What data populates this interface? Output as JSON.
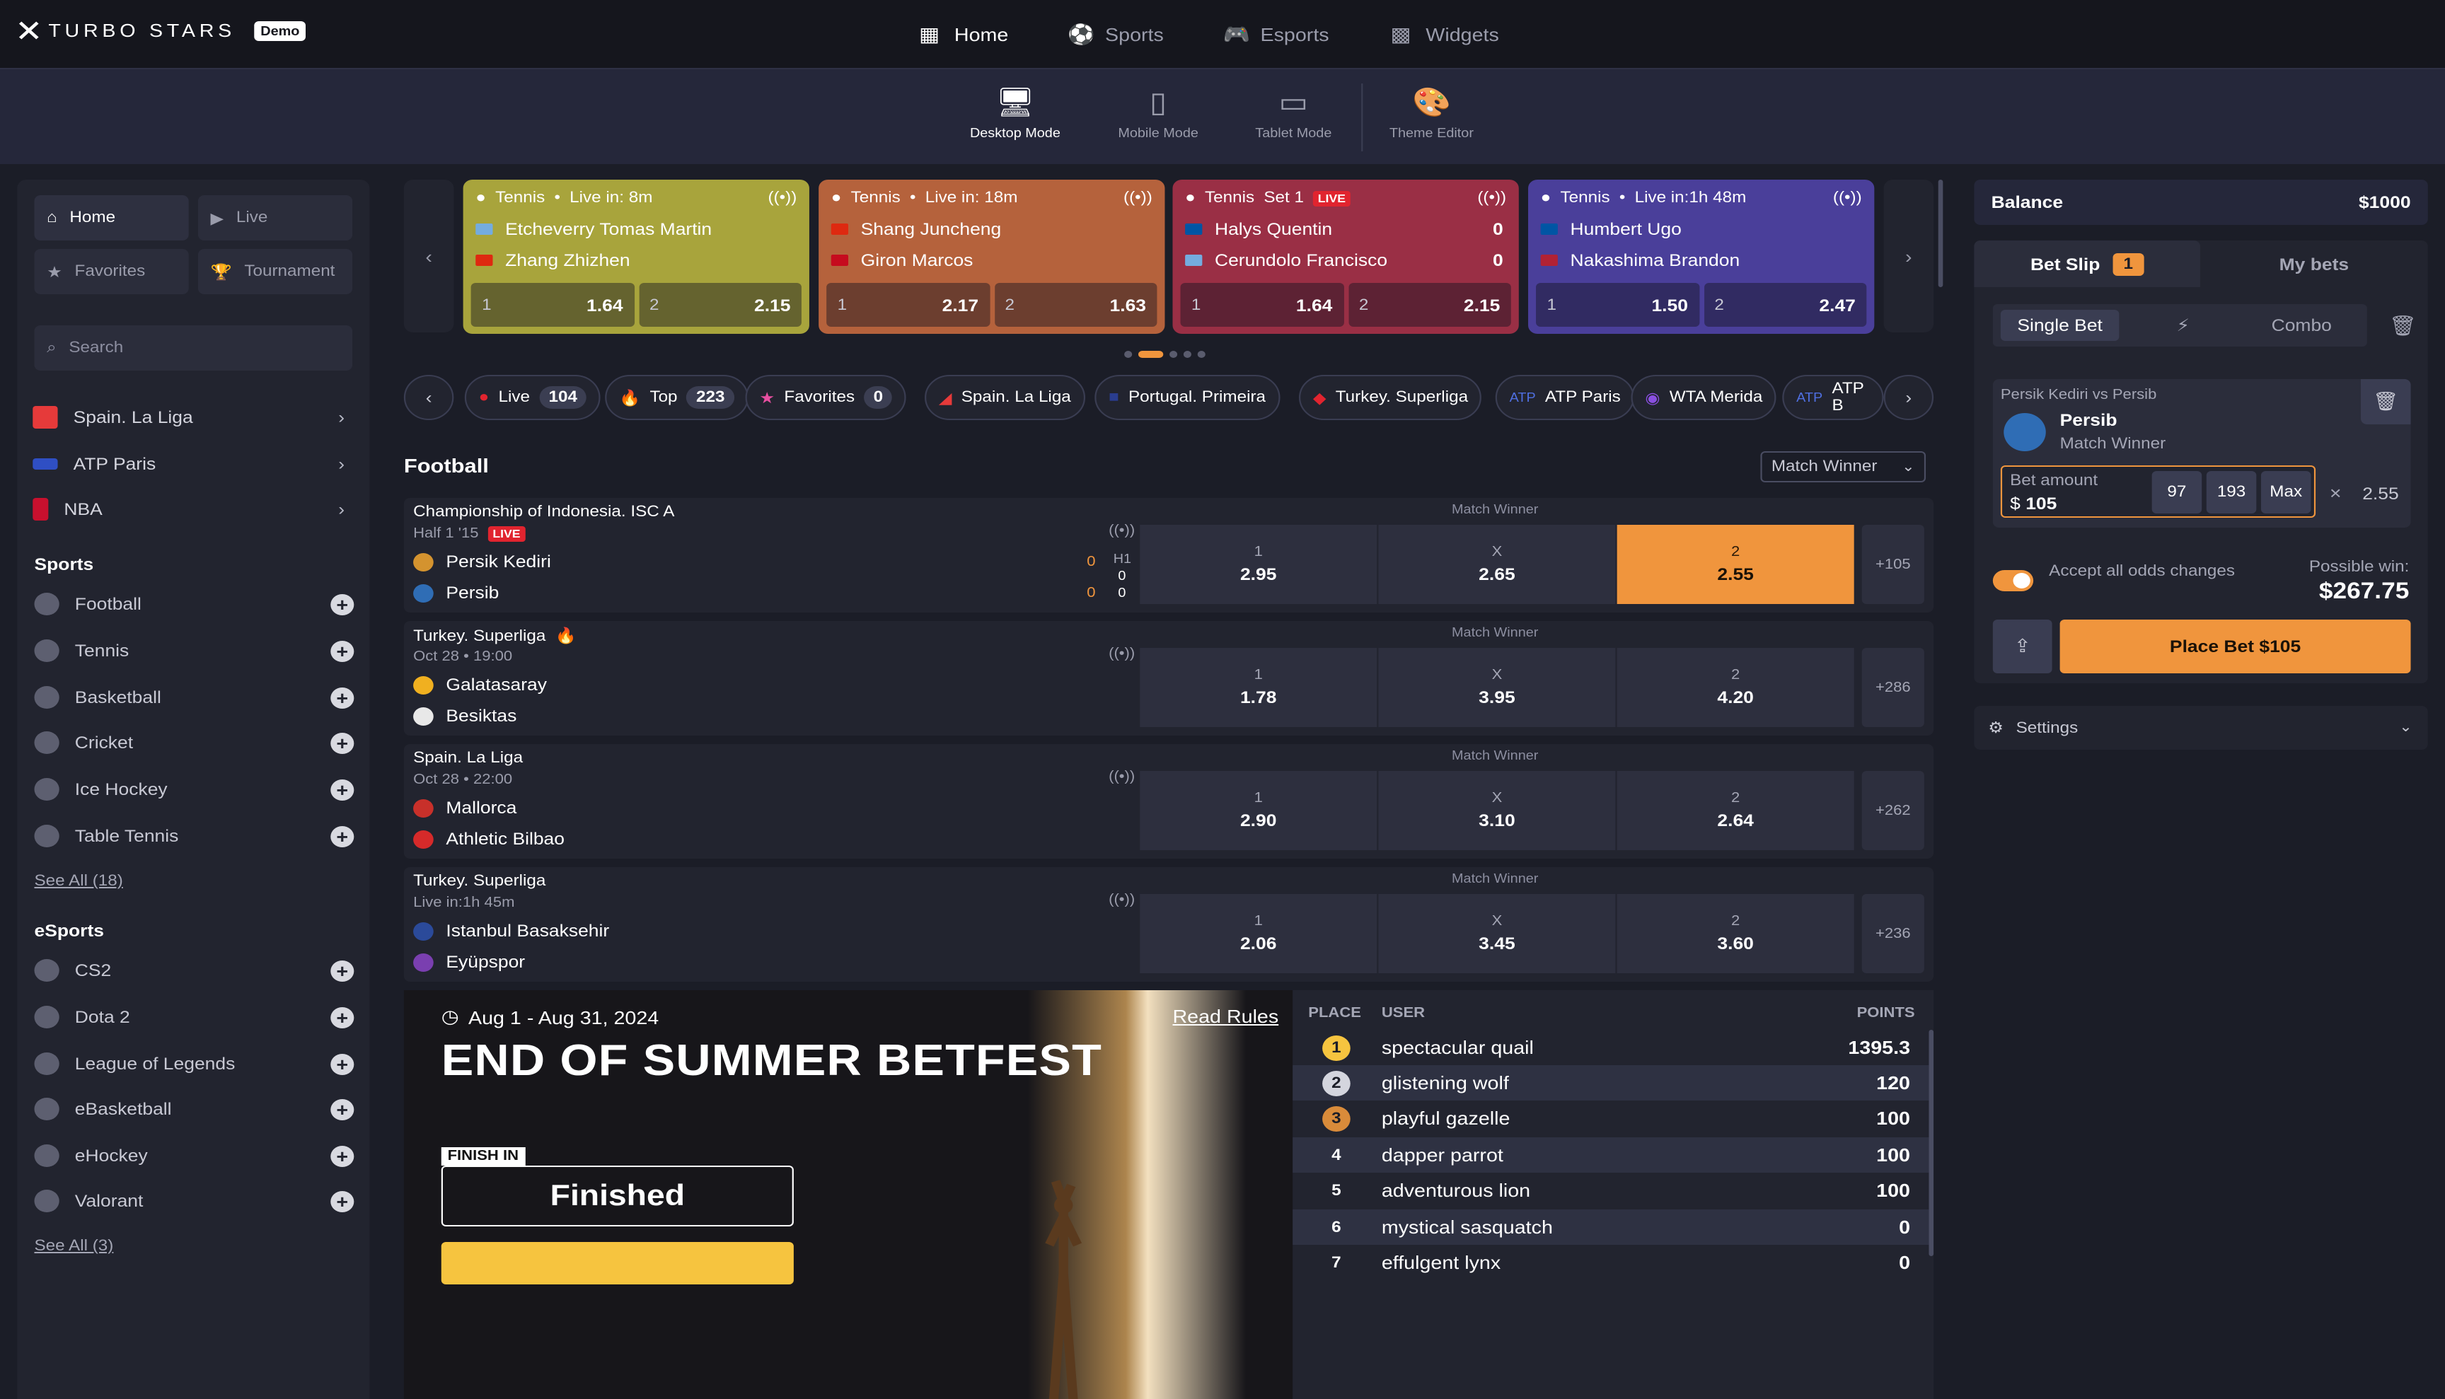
{
  "brand": {
    "name": "TURBO STARS",
    "badge": "Demo"
  },
  "topnav": [
    {
      "label": "Home",
      "icon": "grid-icon",
      "active": true
    },
    {
      "label": "Sports",
      "icon": "soccer-ball-icon",
      "active": false
    },
    {
      "label": "Esports",
      "icon": "gamepad-icon",
      "active": false
    },
    {
      "label": "Widgets",
      "icon": "widgets-icon",
      "active": false
    }
  ],
  "modes": [
    {
      "label": "Desktop Mode",
      "icon": "desktop-icon",
      "active": true
    },
    {
      "label": "Mobile Mode",
      "icon": "mobile-icon",
      "active": false
    },
    {
      "label": "Tablet Mode",
      "icon": "tablet-icon",
      "active": false
    },
    {
      "label": "Theme Editor",
      "icon": "palette-icon",
      "active": false
    }
  ],
  "sidebar": {
    "buttons": [
      {
        "label": "Home",
        "icon": "home-icon",
        "active": true
      },
      {
        "label": "Live",
        "icon": "play-icon",
        "active": false
      },
      {
        "label": "Favorites",
        "icon": "star-icon",
        "active": false
      },
      {
        "label": "Tournament",
        "icon": "trophy-icon",
        "active": false
      }
    ],
    "search_placeholder": "Search",
    "top_links": [
      {
        "label": "Spain. La Liga",
        "icon": "laliga-icon"
      },
      {
        "label": "ATP Paris",
        "icon": "atp-icon"
      },
      {
        "label": "NBA",
        "icon": "nba-icon"
      }
    ],
    "sports_title": "Sports",
    "sports": [
      {
        "label": "Football",
        "icon": "football-icon"
      },
      {
        "label": "Tennis",
        "icon": "tennis-icon"
      },
      {
        "label": "Basketball",
        "icon": "basketball-icon"
      },
      {
        "label": "Cricket",
        "icon": "cricket-icon"
      },
      {
        "label": "Ice Hockey",
        "icon": "ice-hockey-icon"
      },
      {
        "label": "Table Tennis",
        "icon": "table-tennis-icon"
      }
    ],
    "sports_see_all": "See All (18)",
    "esports_title": "eSports",
    "esports": [
      {
        "label": "CS2",
        "icon": "cs2-icon"
      },
      {
        "label": "Dota 2",
        "icon": "dota2-icon"
      },
      {
        "label": "League of Legends",
        "icon": "lol-icon"
      },
      {
        "label": "eBasketball",
        "icon": "ebasketball-icon"
      },
      {
        "label": "eHockey",
        "icon": "ehockey-icon"
      },
      {
        "label": "Valorant",
        "icon": "valorant-icon"
      }
    ],
    "esports_see_all": "See All (3)"
  },
  "live_cards": [
    {
      "sport": "Tennis",
      "status": "Live in: 8m",
      "live": false,
      "color": "#a8a43c",
      "team1": "Etcheverry Tomas Martin",
      "team2": "Zhang Zhizhen",
      "score1": "",
      "score2": "",
      "odds": [
        {
          "label": "1",
          "value": "1.64"
        },
        {
          "label": "2",
          "value": "2.15"
        }
      ]
    },
    {
      "sport": "Tennis",
      "status": "Live in: 18m",
      "live": false,
      "color": "#b5623c",
      "team1": "Shang Juncheng",
      "team2": "Giron Marcos",
      "score1": "",
      "score2": "",
      "odds": [
        {
          "label": "1",
          "value": "2.17"
        },
        {
          "label": "2",
          "value": "1.63"
        }
      ]
    },
    {
      "sport": "Tennis",
      "status": "Set 1",
      "live": true,
      "live_label": "LIVE",
      "color": "#9a2f45",
      "team1": "Halys Quentin",
      "team2": "Cerundolo Francisco",
      "score1": "0",
      "score2": "0",
      "odds": [
        {
          "label": "1",
          "value": "1.64"
        },
        {
          "label": "2",
          "value": "2.15"
        }
      ]
    },
    {
      "sport": "Tennis",
      "status": "Live in:1h 48m",
      "live": false,
      "color": "#4a3f9a",
      "team1": "Humbert Ugo",
      "team2": "Nakashima Brandon",
      "score1": "",
      "score2": "",
      "odds": [
        {
          "label": "1",
          "value": "1.50"
        },
        {
          "label": "2",
          "value": "2.47"
        }
      ]
    }
  ],
  "chips": [
    {
      "label": "Live",
      "count": "104",
      "icon": "live-dot-icon"
    },
    {
      "label": "Top",
      "count": "223",
      "icon": "fire-icon"
    },
    {
      "label": "Favorites",
      "count": "0",
      "icon": "star-icon"
    },
    {
      "label": "Spain. La Liga",
      "count": "",
      "icon": "laliga-icon"
    },
    {
      "label": "Portugal. Primeira",
      "count": "",
      "icon": "primeira-icon"
    },
    {
      "label": "Turkey. Superliga",
      "count": "",
      "icon": "superliga-icon"
    },
    {
      "label": "ATP Paris",
      "count": "",
      "icon": "atp-icon"
    },
    {
      "label": "WTA Merida",
      "count": "",
      "icon": "wta-icon"
    },
    {
      "label": "ATP B",
      "count": "",
      "icon": "atp-icon"
    }
  ],
  "section_title": "Football",
  "market_select": "Match Winner",
  "events": [
    {
      "league": "Championship of Indonesia. ISC A",
      "time": "Half 1 '15",
      "live": true,
      "live_label": "LIVE",
      "team1": "Persik Kediri",
      "team2": "Persib",
      "show_score": true,
      "score_half_label": "H1",
      "score1": "0",
      "score2": "0",
      "score1_h": "0",
      "score2_h": "0",
      "market": "Match Winner",
      "odds": [
        {
          "label": "1",
          "value": "2.95",
          "selected": false
        },
        {
          "label": "X",
          "value": "2.65",
          "selected": false
        },
        {
          "label": "2",
          "value": "2.55",
          "selected": true
        }
      ],
      "more": "+105"
    },
    {
      "league": "Turkey. Superliga",
      "time": "Oct 28 • 19:00",
      "live": false,
      "hot": true,
      "team1": "Galatasaray",
      "team2": "Besiktas",
      "show_score": false,
      "market": "Match Winner",
      "odds": [
        {
          "label": "1",
          "value": "1.78",
          "selected": false
        },
        {
          "label": "X",
          "value": "3.95",
          "selected": false
        },
        {
          "label": "2",
          "value": "4.20",
          "selected": false
        }
      ],
      "more": "+286"
    },
    {
      "league": "Spain. La Liga",
      "time": "Oct 28 • 22:00",
      "live": false,
      "team1": "Mallorca",
      "team2": "Athletic Bilbao",
      "show_score": false,
      "market": "Match Winner",
      "odds": [
        {
          "label": "1",
          "value": "2.90",
          "selected": false
        },
        {
          "label": "X",
          "value": "3.10",
          "selected": false
        },
        {
          "label": "2",
          "value": "2.64",
          "selected": false
        }
      ],
      "more": "+262"
    },
    {
      "league": "Turkey. Superliga",
      "time": "Live in:1h 45m",
      "live": false,
      "team1": "Istanbul Basaksehir",
      "team2": "Eyüpspor",
      "show_score": false,
      "market": "Match Winner",
      "odds": [
        {
          "label": "1",
          "value": "2.06",
          "selected": false
        },
        {
          "label": "X",
          "value": "3.45",
          "selected": false
        },
        {
          "label": "2",
          "value": "3.60",
          "selected": false
        }
      ],
      "more": "+236"
    }
  ],
  "promo": {
    "dates": "Aug 1 - Aug 31, 2024",
    "rules": "Read Rules",
    "title": "END OF SUMMER BETFEST",
    "finish_label": "FINISH IN",
    "status": "Finished"
  },
  "leaderboard": {
    "headers": {
      "place": "PLACE",
      "user": "USER",
      "points": "POINTS"
    },
    "rows": [
      {
        "place": "1",
        "user": "spectacular quail",
        "points": "1395.3",
        "medal": "#f6c43f"
      },
      {
        "place": "2",
        "user": "glistening wolf",
        "points": "120",
        "medal": "#d4d5de"
      },
      {
        "place": "3",
        "user": "playful gazelle",
        "points": "100",
        "medal": "#d98b3a"
      },
      {
        "place": "4",
        "user": "dapper parrot",
        "points": "100",
        "medal": ""
      },
      {
        "place": "5",
        "user": "adventurous lion",
        "points": "100",
        "medal": ""
      },
      {
        "place": "6",
        "user": "mystical sasquatch",
        "points": "0",
        "medal": ""
      },
      {
        "place": "7",
        "user": "effulgent lynx",
        "points": "0",
        "medal": ""
      }
    ]
  },
  "right": {
    "balance_label": "Balance",
    "balance_value": "$1000",
    "tabs": [
      {
        "label": "Bet Slip",
        "badge": "1",
        "active": true
      },
      {
        "label": "My bets",
        "badge": "",
        "active": false
      }
    ],
    "modes": [
      {
        "label": "Single Bet",
        "active": true
      },
      {
        "label": "",
        "icon": "lightning-icon",
        "active": false
      },
      {
        "label": "Combo",
        "active": false
      }
    ],
    "bet": {
      "match": "Persik Kediri vs Persib",
      "selection": "Persib",
      "market": "Match Winner",
      "amount_label": "Bet amount",
      "currency": "$",
      "amount": "105",
      "quick": [
        "97",
        "193",
        "Max"
      ],
      "odd": "2.55"
    },
    "accept_text": "Accept all odds changes",
    "possible_win_label": "Possible win:",
    "possible_win_value": "$267.75",
    "place_label": "Place Bet $105",
    "settings_label": "Settings"
  }
}
